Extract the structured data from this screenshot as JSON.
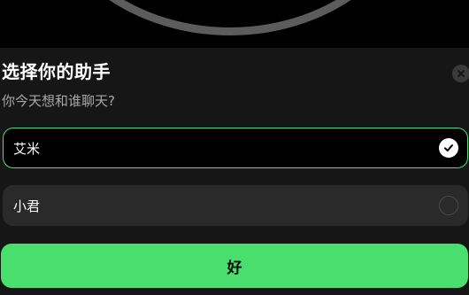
{
  "sheet": {
    "title": "选择你的助手",
    "subtitle": "你今天想和谁聊天?",
    "close_icon": "close-icon"
  },
  "options": [
    {
      "label": "艾米",
      "selected": true,
      "indicator_icon": "check-icon"
    },
    {
      "label": "小君",
      "selected": false,
      "indicator_icon": "radio-empty-icon"
    }
  ],
  "confirm": {
    "label": "好"
  },
  "colors": {
    "accent": "#4ade6e",
    "selected_border": "#4ade80",
    "sheet_bg": "#161616",
    "option_bg": "#2a2a2a"
  }
}
